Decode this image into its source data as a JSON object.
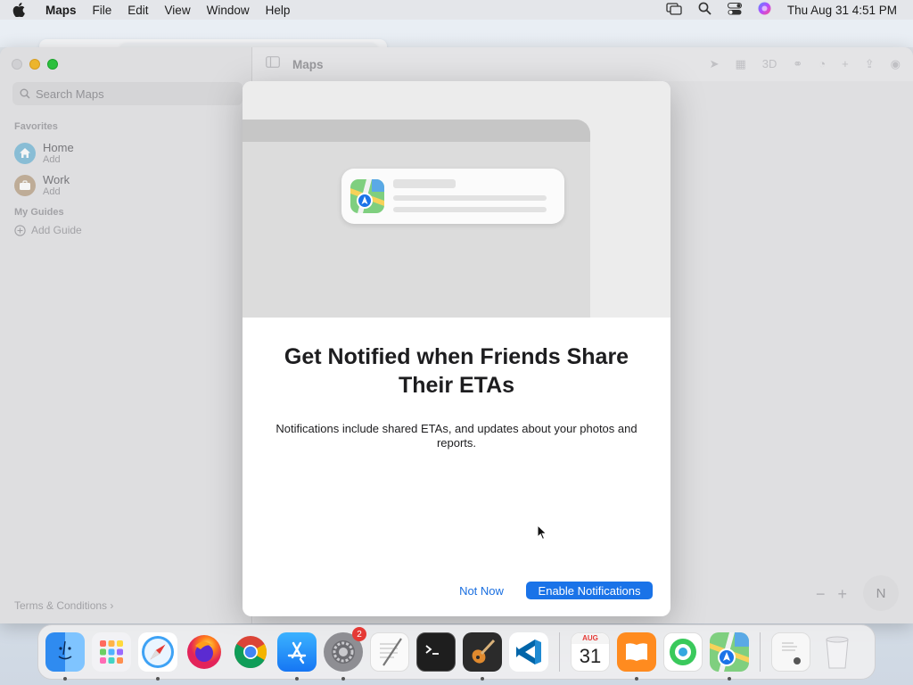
{
  "menubar": {
    "app_name": "Maps",
    "items": [
      "File",
      "Edit",
      "View",
      "Window",
      "Help"
    ],
    "clock": "Thu Aug 31  4:51 PM"
  },
  "window": {
    "title": "Maps",
    "search_placeholder": "Search Maps",
    "favorites_title": "Favorites",
    "favorites": [
      {
        "name": "Home",
        "sub": "Add"
      },
      {
        "name": "Work",
        "sub": "Add"
      }
    ],
    "guides_title": "My Guides",
    "add_guide": "Add Guide",
    "terms": "Terms & Conditions",
    "toolbar_3d": "3D",
    "compass": "N",
    "zoom_out": "−",
    "zoom_in": "+"
  },
  "dialog": {
    "title": "Get Notified when Friends Share Their ETAs",
    "body": "Notifications include shared ETAs, and updates about your photos and reports.",
    "secondary_button": "Not Now",
    "primary_button": "Enable Notifications"
  },
  "dock": {
    "calendar_month": "AUG",
    "calendar_day": "31",
    "settings_badge": "2",
    "apps": [
      "finder",
      "launchpad",
      "safari",
      "firefox",
      "chrome",
      "app-store",
      "system-settings",
      "textedit",
      "terminal",
      "guitar",
      "vscode",
      "calendar",
      "books",
      "find-my",
      "maps",
      "preview",
      "trash"
    ]
  },
  "colors": {
    "accent": "#1a73e8",
    "link": "#1a6fe0"
  }
}
